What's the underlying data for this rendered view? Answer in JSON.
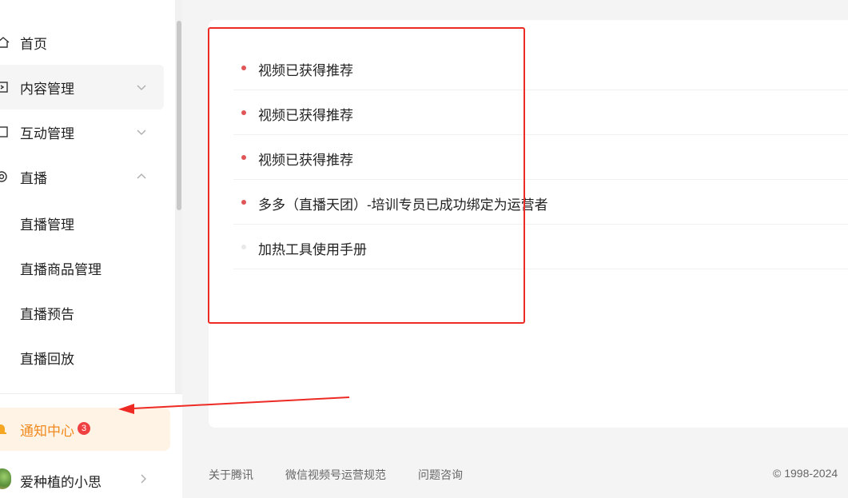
{
  "sidebar": {
    "items": [
      {
        "label": "首页",
        "icon": "home-icon"
      },
      {
        "label": "内容管理",
        "icon": "content-icon"
      },
      {
        "label": "互动管理",
        "icon": "interaction-icon"
      },
      {
        "label": "直播",
        "icon": "live-icon"
      }
    ],
    "live_sub_items": [
      "直播管理",
      "直播商品管理",
      "直播预告",
      "直播回放"
    ],
    "notification": {
      "label": "通知中心",
      "badge": "3",
      "icon": "bell-icon"
    },
    "user": {
      "name": "爱种植的小思"
    }
  },
  "notifications": [
    {
      "text": "视频已获得推荐",
      "unread": true
    },
    {
      "text": "视频已获得推荐",
      "unread": true
    },
    {
      "text": "视频已获得推荐",
      "unread": true
    },
    {
      "text": "多多（直播天团）-培训专员已成功绑定为运营者",
      "unread": true
    },
    {
      "text": "加热工具使用手册",
      "unread": false
    }
  ],
  "footer": {
    "links": [
      "关于腾讯",
      "微信视频号运营规范",
      "问题咨询"
    ],
    "copyright": "© 1998-2024"
  },
  "colors": {
    "accent_orange": "#f08a1e",
    "unread_dot": "#e05656",
    "annotation_red": "#ee2a24"
  }
}
